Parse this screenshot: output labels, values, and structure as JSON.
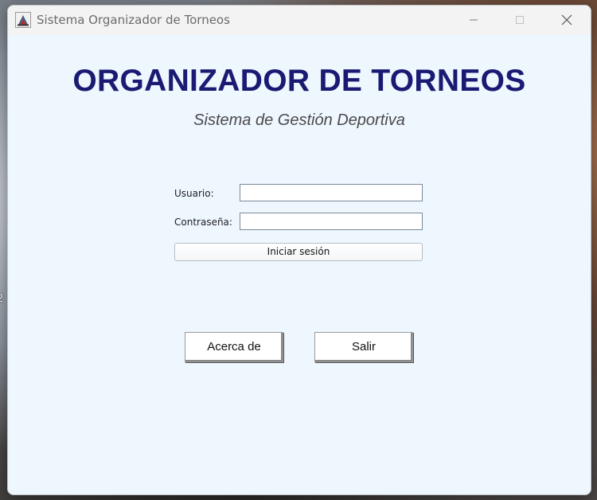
{
  "desktop": {
    "edge_text": "2"
  },
  "window": {
    "title": "Sistema Organizador de Torneos",
    "app_icon": "java-coffee-cup-icon",
    "controls": {
      "minimize_icon": "minimize-icon",
      "maximize_icon": "maximize-icon",
      "close_icon": "close-icon"
    }
  },
  "header": {
    "title": "ORGANIZADOR DE TORNEOS",
    "subtitle": "Sistema de Gestión Deportiva"
  },
  "login_form": {
    "user_label": "Usuario:",
    "user_value": "",
    "password_label": "Contraseña:",
    "password_value": "",
    "submit_label": "Iniciar sesión"
  },
  "actions": {
    "about_label": "Acerca de",
    "exit_label": "Salir"
  },
  "colors": {
    "title_color": "#1a1a73",
    "window_background": "#eef6fe"
  }
}
